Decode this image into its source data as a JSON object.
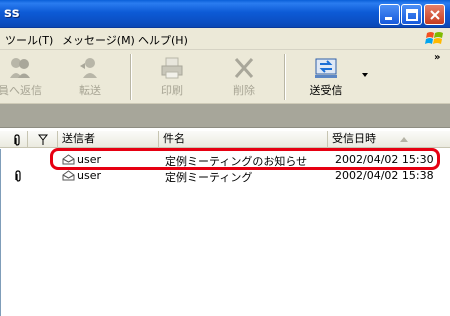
{
  "window": {
    "title": "ss"
  },
  "menu": {
    "tools": "ツール(T)",
    "message": "メッセージ(M)",
    "help": "ヘルプ(H)"
  },
  "toolbar": {
    "reply_all": "員へ返信",
    "forward": "転送",
    "print": "印刷",
    "delete": "削除",
    "send_receive": "送受信",
    "more": "»"
  },
  "columns": {
    "attach_icon": "paperclip-icon",
    "flag_icon": "flag-icon",
    "sender": "送信者",
    "subject": "件名",
    "date": "受信日時"
  },
  "messages": [
    {
      "sender": "user",
      "subject": "定例ミーティングのお知らせ",
      "date": "2002/04/02 15:30",
      "attachment": false
    },
    {
      "sender": "user",
      "subject": "定例ミーティング",
      "date": "2002/04/02 15:38",
      "attachment": true
    }
  ],
  "colors": {
    "titlebar": "#0b4fc4",
    "chrome": "#ece9d8",
    "folderbar": "#a7a69a",
    "highlight": "#e60012"
  }
}
